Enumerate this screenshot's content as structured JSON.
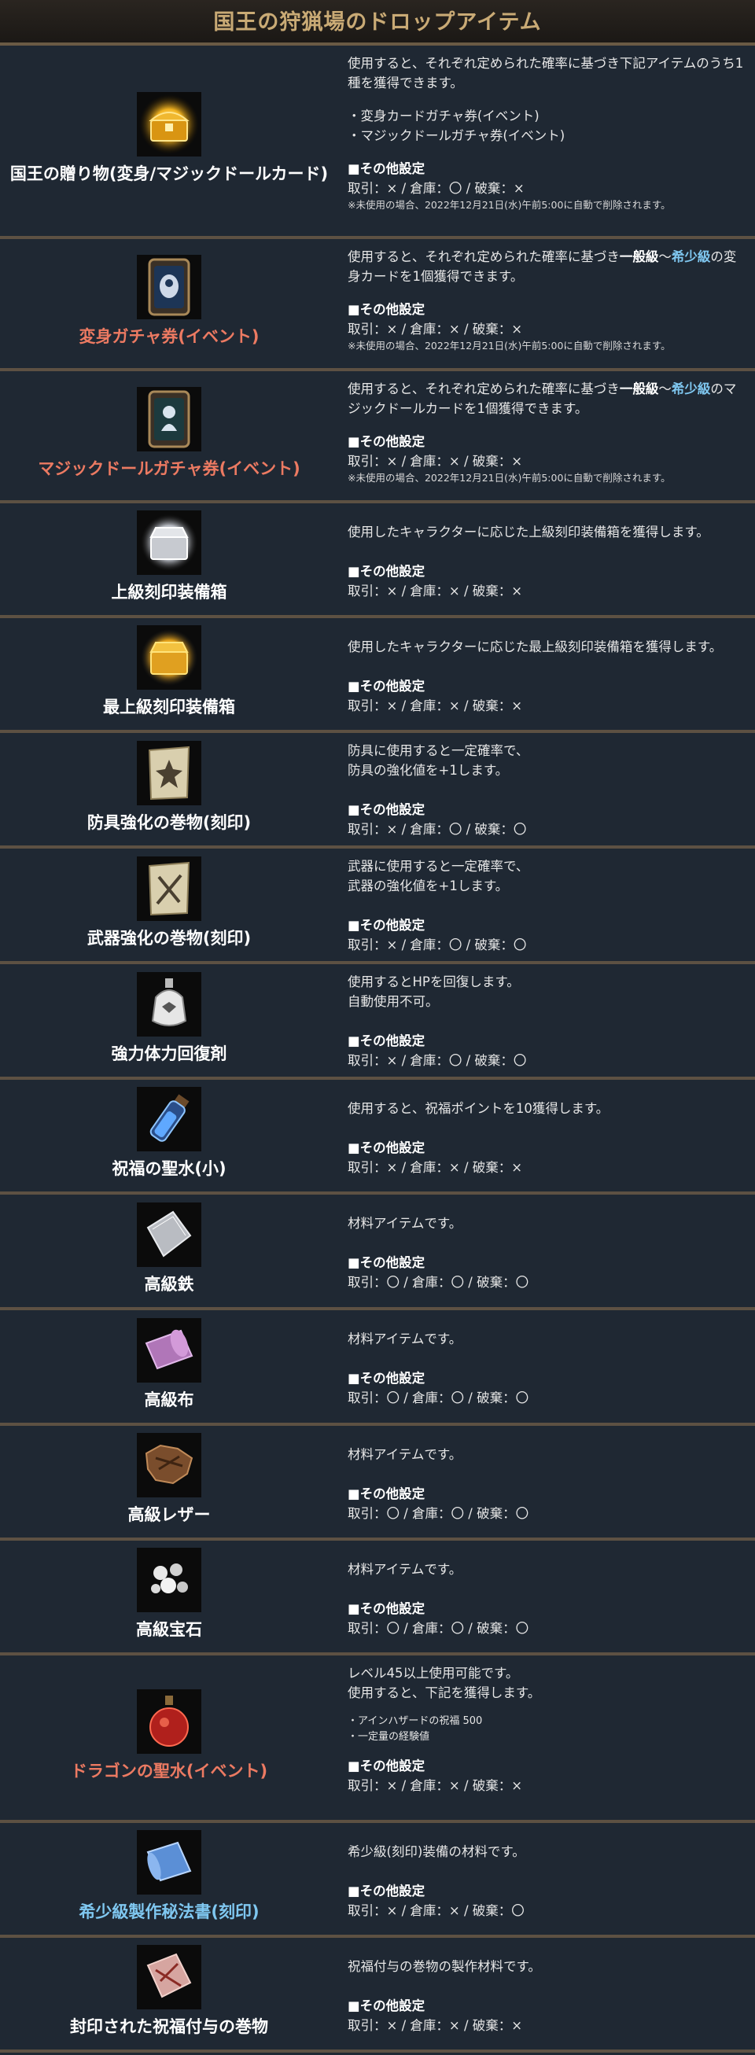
{
  "title": "国王の狩猟場のドロップアイテム",
  "settings_heading": "■その他設定",
  "items": [
    {
      "name": "国王の贈り物(変身/マジックドールカード)",
      "icon": "golden-chest-icon",
      "desc": "使用すると、それぞれ定められた確率に基づき下記アイテムのうち1種を獲得できます。",
      "bullets": [
        "・変身カードガチャ券(イベント)",
        "・マジックドールガチャ券(イベント)"
      ],
      "settings": "取引：× / 倉庫：〇 / 破棄：×",
      "note": "※未使用の場合、2022年12月21日(水)午前5:00に自動で削除されます。"
    },
    {
      "name": "変身ガチャ券(イベント)",
      "icon": "transform-ticket-icon",
      "desc_a": "使用すると、それぞれ定められた確率に基づき",
      "hl1": "一般級",
      "sep": "～",
      "hl2": "希少級",
      "desc_b": "の変身カードを1個獲得できます。",
      "settings": "取引：× / 倉庫：× / 破棄：×",
      "note": "※未使用の場合、2022年12月21日(水)午前5:00に自動で削除されます。"
    },
    {
      "name": "マジックドールガチャ券(イベント)",
      "icon": "doll-ticket-icon",
      "desc_a": "使用すると、それぞれ定められた確率に基づき",
      "hl1": "一般級",
      "sep": "～",
      "hl2": "希少級",
      "desc_b": "のマジックドールカードを1個獲得できます。",
      "settings": "取引：× / 倉庫：× / 破棄：×",
      "note": "※未使用の場合、2022年12月21日(水)午前5:00に自動で削除されます。"
    },
    {
      "name": "上級刻印装備箱",
      "icon": "silver-chest-icon",
      "desc": "使用したキャラクターに応じた上級刻印装備箱を獲得します。",
      "settings": "取引：× / 倉庫：× / 破棄：×"
    },
    {
      "name": "最上級刻印装備箱",
      "icon": "gold-chest-icon",
      "desc": "使用したキャラクターに応じた最上級刻印装備箱を獲得します。",
      "settings": "取引：× / 倉庫：× / 破棄：×"
    },
    {
      "name": "防具強化の巻物(刻印)",
      "icon": "armor-scroll-icon",
      "desc": "防具に使用すると一定確率で、\n防具の強化値を+1します。",
      "settings": "取引：× / 倉庫：〇 / 破棄：〇"
    },
    {
      "name": "武器強化の巻物(刻印)",
      "icon": "weapon-scroll-icon",
      "desc": "武器に使用すると一定確率で、\n武器の強化値を+1します。",
      "settings": "取引：× / 倉庫：〇 / 破棄：〇"
    },
    {
      "name": "強力体力回復剤",
      "icon": "potion-pouch-icon",
      "desc": "使用するとHPを回復します。\n自動使用不可。",
      "settings": "取引：× / 倉庫：〇 / 破棄：〇"
    },
    {
      "name": "祝福の聖水(小)",
      "icon": "holy-water-icon",
      "desc": "使用すると、祝福ポイントを10獲得します。",
      "settings": "取引：× / 倉庫：× / 破棄：×"
    },
    {
      "name": "高級鉄",
      "icon": "iron-sheet-icon",
      "desc": "材料アイテムです。",
      "settings": "取引：〇 / 倉庫：〇 / 破棄：〇"
    },
    {
      "name": "高級布",
      "icon": "cloth-roll-icon",
      "desc": "材料アイテムです。",
      "settings": "取引：〇 / 倉庫：〇 / 破棄：〇"
    },
    {
      "name": "高級レザー",
      "icon": "leather-icon",
      "desc": "材料アイテムです。",
      "settings": "取引：〇 / 倉庫：〇 / 破棄：〇"
    },
    {
      "name": "高級宝石",
      "icon": "gems-icon",
      "desc": "材料アイテムです。",
      "settings": "取引：〇 / 倉庫：〇 / 破棄：〇"
    },
    {
      "name": "ドラゴンの聖水(イベント)",
      "icon": "dragon-potion-icon",
      "desc": "レベル45以上使用可能です。\n使用すると、下記を獲得します。",
      "bullets": [
        "・アインハザードの祝福 500",
        "・一定量の経験値"
      ],
      "settings": "取引：× / 倉庫：× / 破棄：×"
    },
    {
      "name": "希少級製作秘法書(刻印)",
      "icon": "blue-scroll-icon",
      "desc": "希少級(刻印)装備の材料です。",
      "settings": "取引：× / 倉庫：× / 破棄：〇"
    },
    {
      "name": "封印された祝福付与の巻物",
      "icon": "sealed-scroll-icon",
      "desc": "祝福付与の巻物の製作材料です。",
      "settings": "取引：× / 倉庫：× / 破棄：×"
    }
  ]
}
